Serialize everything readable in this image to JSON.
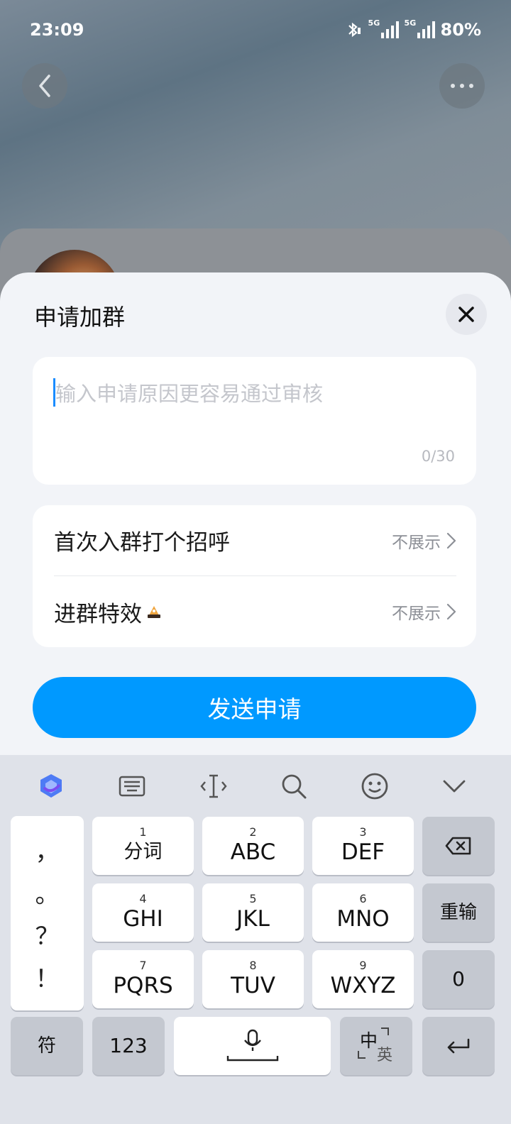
{
  "status": {
    "time": "23:09",
    "battery": "80%",
    "network_1": "5G",
    "network_2": "5G"
  },
  "dialog": {
    "title": "申请加群",
    "placeholder": "输入申请原因更容易通过审核",
    "counter": "0/30",
    "rows": [
      {
        "label": "首次入群打个招呼",
        "value": "不展示"
      },
      {
        "label": "进群特效",
        "value": "不展示"
      }
    ],
    "send_label": "发送申请"
  },
  "keyboard": {
    "punctuation": [
      "，",
      "。",
      "？",
      "！"
    ],
    "keys": [
      {
        "num": "1",
        "label": "分词"
      },
      {
        "num": "2",
        "label": "ABC"
      },
      {
        "num": "3",
        "label": "DEF"
      },
      {
        "num": "4",
        "label": "GHI"
      },
      {
        "num": "5",
        "label": "JKL"
      },
      {
        "num": "6",
        "label": "MNO"
      },
      {
        "num": "7",
        "label": "PQRS"
      },
      {
        "num": "8",
        "label": "TUV"
      },
      {
        "num": "9",
        "label": "WXYZ"
      }
    ],
    "reinput": "重输",
    "zero": "0",
    "symbols": "符",
    "numbers": "123",
    "lang_zh": "中",
    "lang_en": "英"
  },
  "colors": {
    "accent": "#0099ff",
    "caret": "#1a8cff"
  }
}
